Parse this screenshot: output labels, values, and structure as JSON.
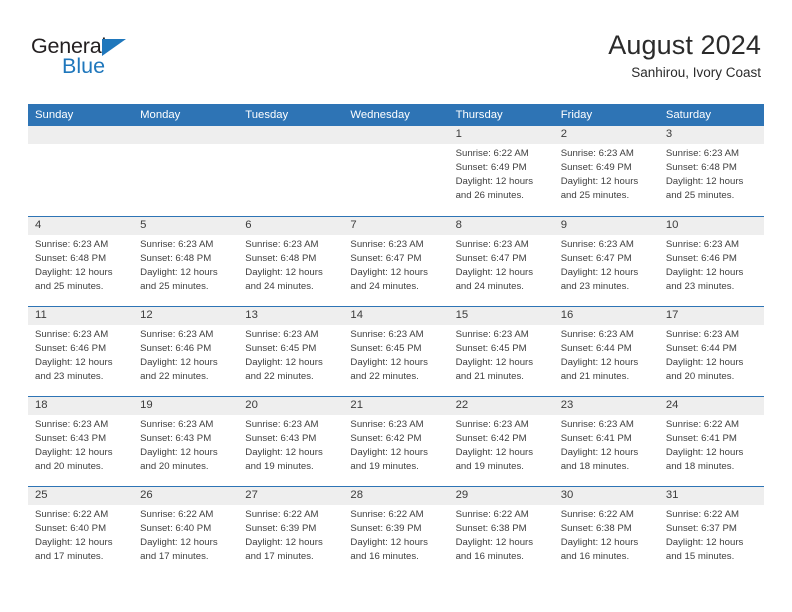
{
  "brand": {
    "name_top": "General",
    "name_bottom": "Blue",
    "triangle_color": "#1f77bc",
    "top_color": "#231f20"
  },
  "header": {
    "title": "August 2024",
    "subtitle": "Sanhirou, Ivory Coast"
  },
  "theme": {
    "accent": "#2e74b5",
    "daynum_band": "#eeeeee",
    "text": "#3f3f3f",
    "header_text": "#ffffff"
  },
  "weekday_headers": [
    "Sunday",
    "Monday",
    "Tuesday",
    "Wednesday",
    "Thursday",
    "Friday",
    "Saturday"
  ],
  "calendar_data": {
    "type": "table",
    "month": "August",
    "year": 2024,
    "location": "Sanhirou, Ivory Coast",
    "weeks": [
      [
        {
          "day": "",
          "lines": []
        },
        {
          "day": "",
          "lines": []
        },
        {
          "day": "",
          "lines": []
        },
        {
          "day": "",
          "lines": []
        },
        {
          "day": "1",
          "lines": [
            "Sunrise: 6:22 AM",
            "Sunset: 6:49 PM",
            "Daylight: 12 hours",
            "and 26 minutes."
          ]
        },
        {
          "day": "2",
          "lines": [
            "Sunrise: 6:23 AM",
            "Sunset: 6:49 PM",
            "Daylight: 12 hours",
            "and 25 minutes."
          ]
        },
        {
          "day": "3",
          "lines": [
            "Sunrise: 6:23 AM",
            "Sunset: 6:48 PM",
            "Daylight: 12 hours",
            "and 25 minutes."
          ]
        }
      ],
      [
        {
          "day": "4",
          "lines": [
            "Sunrise: 6:23 AM",
            "Sunset: 6:48 PM",
            "Daylight: 12 hours",
            "and 25 minutes."
          ]
        },
        {
          "day": "5",
          "lines": [
            "Sunrise: 6:23 AM",
            "Sunset: 6:48 PM",
            "Daylight: 12 hours",
            "and 25 minutes."
          ]
        },
        {
          "day": "6",
          "lines": [
            "Sunrise: 6:23 AM",
            "Sunset: 6:48 PM",
            "Daylight: 12 hours",
            "and 24 minutes."
          ]
        },
        {
          "day": "7",
          "lines": [
            "Sunrise: 6:23 AM",
            "Sunset: 6:47 PM",
            "Daylight: 12 hours",
            "and 24 minutes."
          ]
        },
        {
          "day": "8",
          "lines": [
            "Sunrise: 6:23 AM",
            "Sunset: 6:47 PM",
            "Daylight: 12 hours",
            "and 24 minutes."
          ]
        },
        {
          "day": "9",
          "lines": [
            "Sunrise: 6:23 AM",
            "Sunset: 6:47 PM",
            "Daylight: 12 hours",
            "and 23 minutes."
          ]
        },
        {
          "day": "10",
          "lines": [
            "Sunrise: 6:23 AM",
            "Sunset: 6:46 PM",
            "Daylight: 12 hours",
            "and 23 minutes."
          ]
        }
      ],
      [
        {
          "day": "11",
          "lines": [
            "Sunrise: 6:23 AM",
            "Sunset: 6:46 PM",
            "Daylight: 12 hours",
            "and 23 minutes."
          ]
        },
        {
          "day": "12",
          "lines": [
            "Sunrise: 6:23 AM",
            "Sunset: 6:46 PM",
            "Daylight: 12 hours",
            "and 22 minutes."
          ]
        },
        {
          "day": "13",
          "lines": [
            "Sunrise: 6:23 AM",
            "Sunset: 6:45 PM",
            "Daylight: 12 hours",
            "and 22 minutes."
          ]
        },
        {
          "day": "14",
          "lines": [
            "Sunrise: 6:23 AM",
            "Sunset: 6:45 PM",
            "Daylight: 12 hours",
            "and 22 minutes."
          ]
        },
        {
          "day": "15",
          "lines": [
            "Sunrise: 6:23 AM",
            "Sunset: 6:45 PM",
            "Daylight: 12 hours",
            "and 21 minutes."
          ]
        },
        {
          "day": "16",
          "lines": [
            "Sunrise: 6:23 AM",
            "Sunset: 6:44 PM",
            "Daylight: 12 hours",
            "and 21 minutes."
          ]
        },
        {
          "day": "17",
          "lines": [
            "Sunrise: 6:23 AM",
            "Sunset: 6:44 PM",
            "Daylight: 12 hours",
            "and 20 minutes."
          ]
        }
      ],
      [
        {
          "day": "18",
          "lines": [
            "Sunrise: 6:23 AM",
            "Sunset: 6:43 PM",
            "Daylight: 12 hours",
            "and 20 minutes."
          ]
        },
        {
          "day": "19",
          "lines": [
            "Sunrise: 6:23 AM",
            "Sunset: 6:43 PM",
            "Daylight: 12 hours",
            "and 20 minutes."
          ]
        },
        {
          "day": "20",
          "lines": [
            "Sunrise: 6:23 AM",
            "Sunset: 6:43 PM",
            "Daylight: 12 hours",
            "and 19 minutes."
          ]
        },
        {
          "day": "21",
          "lines": [
            "Sunrise: 6:23 AM",
            "Sunset: 6:42 PM",
            "Daylight: 12 hours",
            "and 19 minutes."
          ]
        },
        {
          "day": "22",
          "lines": [
            "Sunrise: 6:23 AM",
            "Sunset: 6:42 PM",
            "Daylight: 12 hours",
            "and 19 minutes."
          ]
        },
        {
          "day": "23",
          "lines": [
            "Sunrise: 6:23 AM",
            "Sunset: 6:41 PM",
            "Daylight: 12 hours",
            "and 18 minutes."
          ]
        },
        {
          "day": "24",
          "lines": [
            "Sunrise: 6:22 AM",
            "Sunset: 6:41 PM",
            "Daylight: 12 hours",
            "and 18 minutes."
          ]
        }
      ],
      [
        {
          "day": "25",
          "lines": [
            "Sunrise: 6:22 AM",
            "Sunset: 6:40 PM",
            "Daylight: 12 hours",
            "and 17 minutes."
          ]
        },
        {
          "day": "26",
          "lines": [
            "Sunrise: 6:22 AM",
            "Sunset: 6:40 PM",
            "Daylight: 12 hours",
            "and 17 minutes."
          ]
        },
        {
          "day": "27",
          "lines": [
            "Sunrise: 6:22 AM",
            "Sunset: 6:39 PM",
            "Daylight: 12 hours",
            "and 17 minutes."
          ]
        },
        {
          "day": "28",
          "lines": [
            "Sunrise: 6:22 AM",
            "Sunset: 6:39 PM",
            "Daylight: 12 hours",
            "and 16 minutes."
          ]
        },
        {
          "day": "29",
          "lines": [
            "Sunrise: 6:22 AM",
            "Sunset: 6:38 PM",
            "Daylight: 12 hours",
            "and 16 minutes."
          ]
        },
        {
          "day": "30",
          "lines": [
            "Sunrise: 6:22 AM",
            "Sunset: 6:38 PM",
            "Daylight: 12 hours",
            "and 16 minutes."
          ]
        },
        {
          "day": "31",
          "lines": [
            "Sunrise: 6:22 AM",
            "Sunset: 6:37 PM",
            "Daylight: 12 hours",
            "and 15 minutes."
          ]
        }
      ]
    ]
  }
}
